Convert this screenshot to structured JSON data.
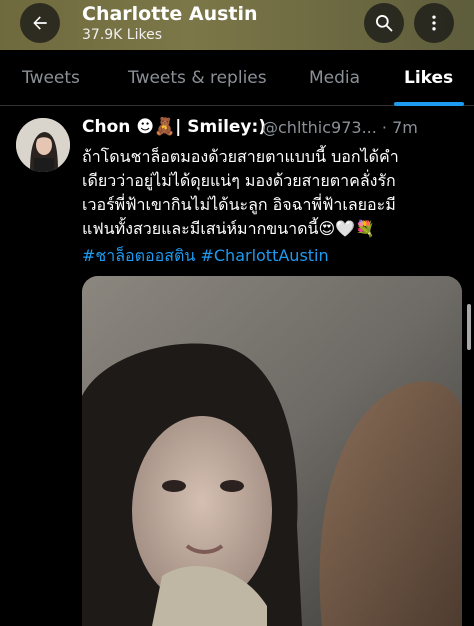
{
  "header": {
    "title": "Charlotte Austin",
    "subtitle": "37.9K Likes",
    "back_icon": "arrow-left-icon",
    "search_icon": "search-icon",
    "more_icon": "more-dots-icon"
  },
  "tabs": [
    {
      "label": "Tweets",
      "active": false
    },
    {
      "label": "Tweets & replies",
      "active": false
    },
    {
      "label": "Media",
      "active": false
    },
    {
      "label": "Likes",
      "active": true
    }
  ],
  "tweet": {
    "display_name": "Chon ☻🧸| Smiley:)",
    "handle_time": "@chlthic973... · 7m",
    "text_lines": [
      "ถ้าโดนชาล็อตมองด้วยสายตาแบบนี้ บอกได้คำ",
      "เดียวว่าอยู่ไม่ได้ดุยแน่ๆ มองด้วยสายตาคลั่งรัก",
      "เวอร์พี่ฟ้าเขากินไม่ได้นะลูก อิจฉาพี่ฟ้าเลยอะมี",
      "แฟนทั้งสวยและมีเสน่ห์มากขนาดนี้😍🤍💐"
    ],
    "hashtags": [
      "#ชาล็อตออสติน",
      "#CharlottAustin"
    ]
  },
  "colors": {
    "accent": "#1d9bf0",
    "background": "#000000",
    "secondary_text": "#8b9096",
    "header_bg": "#77723f"
  }
}
